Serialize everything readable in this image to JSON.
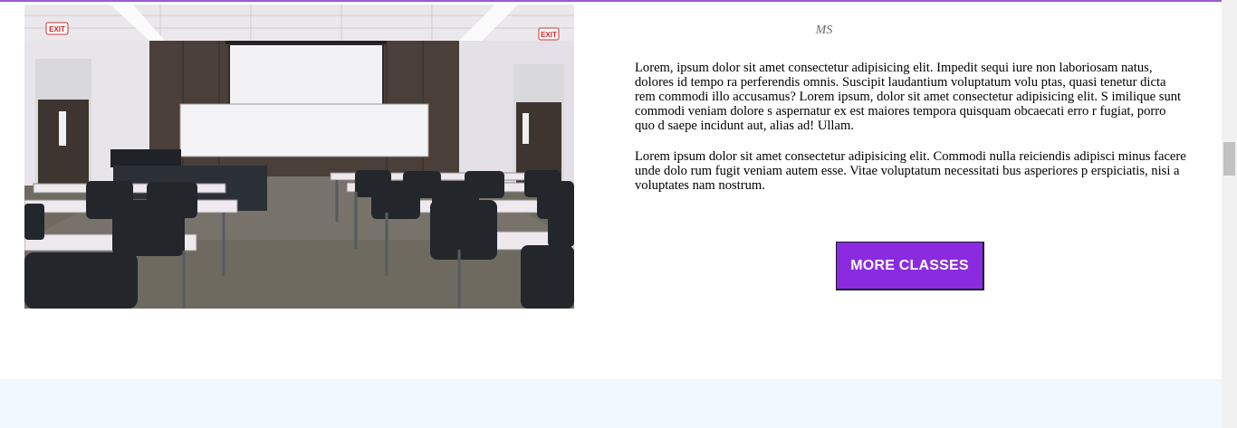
{
  "photo": {
    "alt": "Empty classroom with projector screen, desks and chairs",
    "exit_sign": "EXIT"
  },
  "caption": "MS",
  "content": {
    "paragraph_1": "Lorem, ipsum dolor sit amet consectetur adipisicing elit. Impedit sequi iure non laboriosam natus, dolores id tempo ra perferendis omnis. Suscipit laudantium voluptatum volu ptas, quasi tenetur dicta rem commodi illo accusamus? Lorem ipsum, dolor sit amet consectetur adipisicing elit. S imilique sunt commodi veniam dolore s aspernatur ex est maiores tempora quisquam obcaecati erro r fugiat, porro quo d saepe incidunt aut, alias ad! Ullam.",
    "paragraph_2": "Lorem ipsum dolor sit amet consectetur adipisicing elit. Commodi nulla reiciendis adipisci minus facere unde dolo rum fugit veniam autem esse. Vitae voluptatum necessitati bus asperiores p erspiciatis, nisi a voluptates nam nostrum."
  },
  "button": {
    "label": "MORE CLASSES",
    "background": "#8a2be2",
    "text_color": "#ffffff"
  },
  "colors": {
    "accent_line": "#9b59d6",
    "footer_band": "#f0f7fd"
  }
}
